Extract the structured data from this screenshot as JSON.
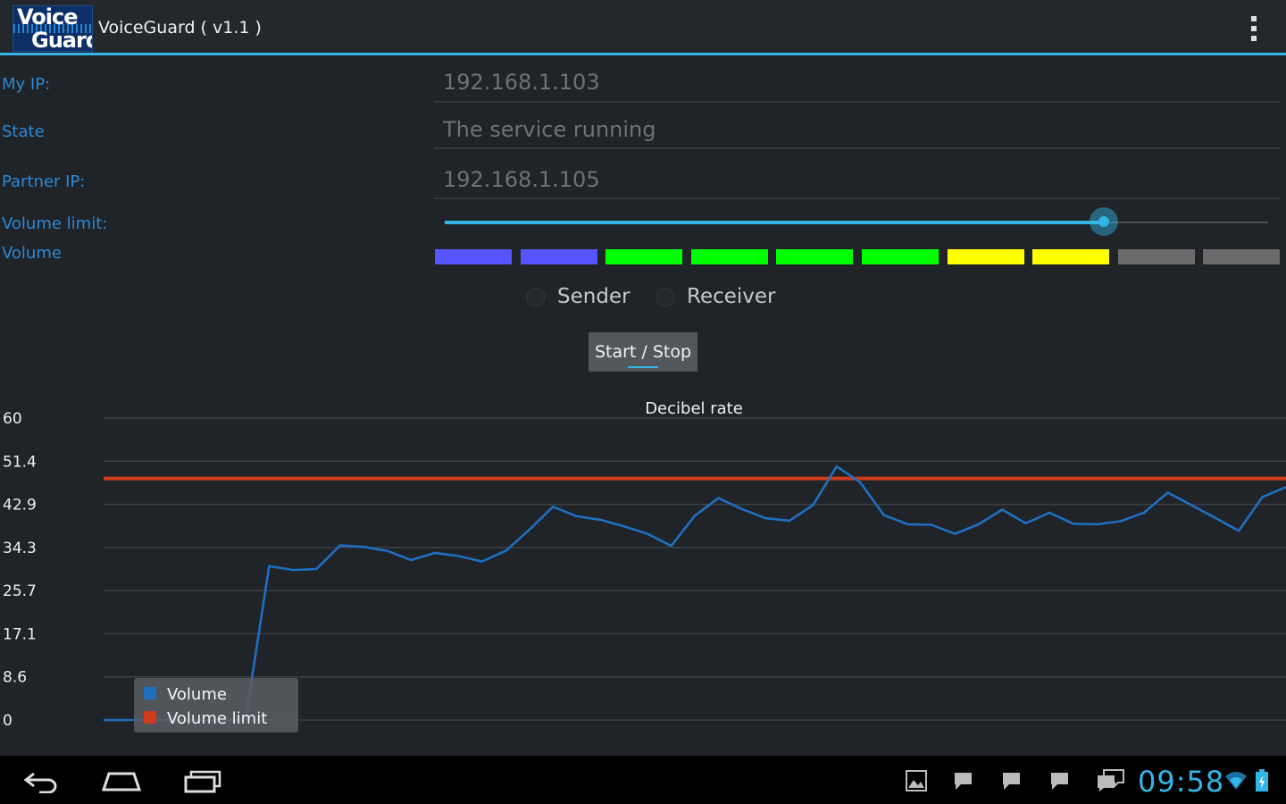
{
  "app": {
    "title": "VoiceGuard ( v1.1 )",
    "logo_line1": "Voice",
    "logo_line2": "Guard",
    "accent_color": "#33b5e5"
  },
  "form": {
    "my_ip_label": "My IP:",
    "my_ip_value": "192.168.1.103",
    "state_label": "State",
    "state_value": "The service running",
    "partner_ip_label": "Partner IP:",
    "partner_ip_value": "192.168.1.105",
    "volume_limit_label": "Volume limit:",
    "volume_limit_level": 0.8,
    "volume_label": "Volume"
  },
  "volume_meter": {
    "colors": [
      "#5555ff",
      "#5555ff",
      "#00ff00",
      "#00ff00",
      "#00ff00",
      "#00ff00",
      "#ffff00",
      "#ffff00",
      "#6b6b6b",
      "#6b6b6b"
    ],
    "active_segments": 8,
    "total_segments": 10
  },
  "mode": {
    "sender_label": "Sender",
    "receiver_label": "Receiver"
  },
  "controls": {
    "start_stop_label": "Start / Stop"
  },
  "chart_data": {
    "type": "line",
    "title": "Decibel rate",
    "xlabel": "",
    "ylabel": "",
    "ylim": [
      0,
      60
    ],
    "yticks": [
      "0",
      "8.6",
      "17.1",
      "25.7",
      "34.3",
      "42.9",
      "51.4",
      "60"
    ],
    "grid": true,
    "legend_position": "bottom-left",
    "series": [
      {
        "name": "Volume",
        "color": "#1f6fc0",
        "x": [
          0,
          1,
          2,
          3,
          4,
          5,
          6,
          7,
          8,
          9,
          10,
          11,
          12,
          13,
          14,
          15,
          16,
          17,
          18,
          19,
          20,
          21,
          22,
          23,
          24,
          25,
          26,
          27,
          28,
          29,
          30,
          31,
          32,
          33,
          34,
          35,
          36,
          37,
          38,
          39,
          40,
          41,
          42,
          43,
          44,
          45,
          46,
          47,
          48,
          49,
          50
        ],
        "values": [
          0,
          0,
          0,
          0,
          0,
          0,
          0,
          30.6,
          29.8,
          30,
          34.7,
          34.4,
          33.6,
          31.8,
          33.2,
          32.6,
          31.5,
          33.6,
          37.8,
          42.4,
          40.5,
          39.8,
          38.5,
          37,
          34.6,
          40.6,
          44.1,
          41.9,
          40.1,
          39.6,
          42.7,
          50.4,
          47.2,
          40.7,
          38.9,
          38.8,
          37,
          38.9,
          41.8,
          39.1,
          41.2,
          39,
          38.9,
          39.5,
          41.2,
          45.2,
          42.7,
          40.2,
          37.6,
          44.3,
          46.3
        ]
      },
      {
        "name": "Volume limit",
        "color": "#d03b1c",
        "x": [
          0,
          50
        ],
        "values": [
          48,
          48
        ]
      }
    ]
  },
  "statusbar": {
    "time": "09:58"
  }
}
